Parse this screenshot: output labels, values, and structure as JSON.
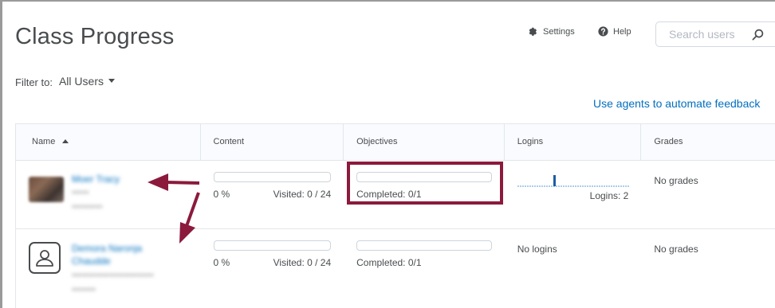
{
  "page": {
    "title": "Class Progress"
  },
  "toolbar": {
    "settings_label": "Settings",
    "help_label": "Help"
  },
  "search": {
    "placeholder": "Search users",
    "value": ""
  },
  "filter": {
    "label": "Filter to:",
    "selected": "All Users"
  },
  "agents_link": "Use agents to automate feedback",
  "table": {
    "columns": [
      "Name",
      "Content",
      "Objectives",
      "Logins",
      "Grades"
    ],
    "sort": {
      "column": "Name",
      "direction": "ascending"
    },
    "rows": [
      {
        "name": "Moer Tracy",
        "sub1": "*****",
        "sub2": "*********",
        "avatar": "user-photo",
        "content_percent": "0 %",
        "content_progress": 0,
        "visited": "Visited: 0 / 24",
        "objectives_progress": 0,
        "objectives": "Completed: 0/1",
        "logins_text": "Logins: 2",
        "logins_chart": [
          0,
          0,
          0,
          0,
          0,
          0,
          1,
          0,
          0,
          0,
          0,
          0
        ],
        "grades": "No grades"
      },
      {
        "name": "Demora Naronja Chaudde",
        "sub1": "************************",
        "sub2": "*******",
        "avatar": "default-user-icon",
        "content_percent": "0 %",
        "content_progress": 0,
        "visited": "Visited: 0 / 24",
        "objectives_progress": 0,
        "objectives": "Completed: 0/1",
        "logins_text": "No logins",
        "grades": "No grades"
      }
    ]
  },
  "colors": {
    "link": "#006fbf",
    "annotation": "#8b1a3c",
    "text": "#494c4e",
    "border": "#e3e6ea"
  }
}
